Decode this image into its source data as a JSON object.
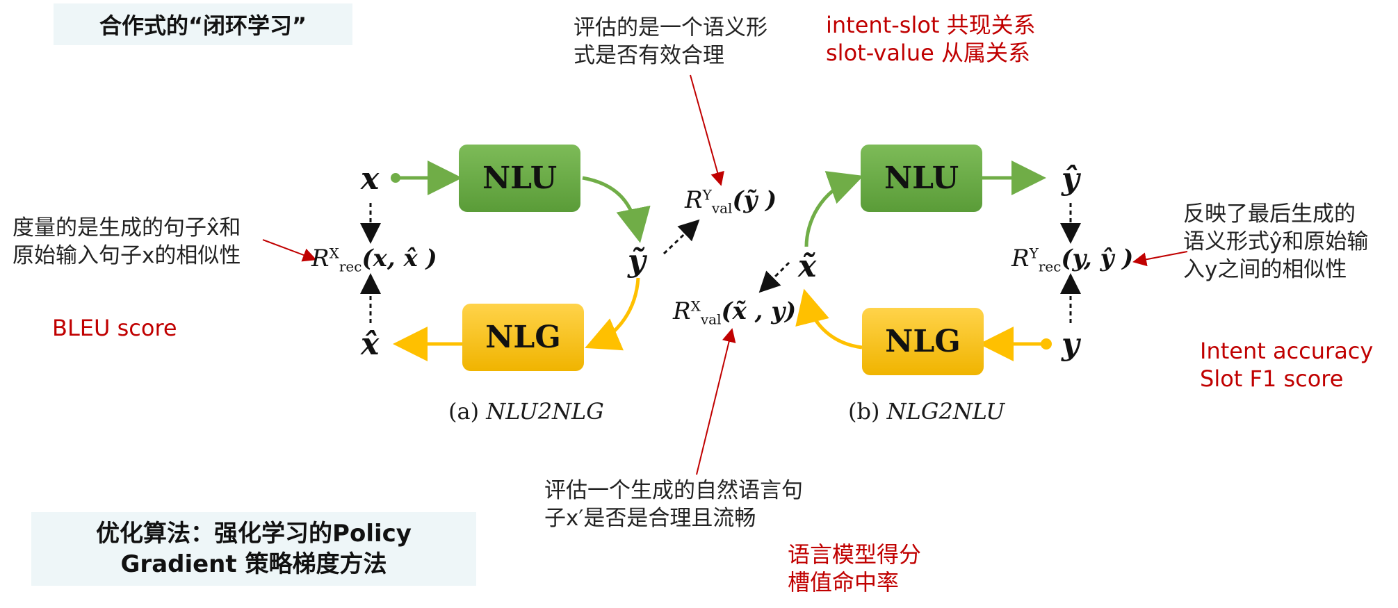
{
  "title_top": "合作式的“闭环学习”",
  "title_bottom_line1": "优化算法：强化学习的Policy",
  "title_bottom_line2": "Gradient 策略梯度方法",
  "boxes": {
    "nlu_left": "NLU",
    "nlg_left": "NLG",
    "nlu_right": "NLU",
    "nlg_right": "NLG"
  },
  "captions": {
    "a_prefix": "(a) ",
    "a_name": "NLU2NLG",
    "b_prefix": "(b) ",
    "b_name": "NLG2NLU"
  },
  "variables": {
    "x": "x",
    "x_hat": "x̂",
    "y_tilde": "ỹ",
    "x_tilde": "x̃",
    "y_hat": "ŷ",
    "y": "y"
  },
  "rewards": {
    "R": "R",
    "rec_x": {
      "sub": "rec",
      "sup": "X",
      "args": "(x, x̂ )"
    },
    "val_y": {
      "sub": "val",
      "sup": "Y",
      "args": "(ỹ )"
    },
    "val_x": {
      "sub": "val",
      "sup": "X",
      "args": "(x̃ , y)"
    },
    "rec_y": {
      "sub": "rec",
      "sup": "Y",
      "args": "(y, ŷ )"
    }
  },
  "notes": {
    "val_y_1": "评估的是一个语义形",
    "val_y_2": "式是否有效合理",
    "rec_x_1": "度量的是生成的句子x̂和",
    "rec_x_2": "原始输入句子x的相似性",
    "rec_y_1": "反映了最后生成的",
    "rec_y_2": "语义形式ŷ和原始输",
    "rec_y_3": "入y之间的相似性",
    "val_x_1": "评估一个生成的自然语言句",
    "val_x_2": "子x′是否是合理且流畅"
  },
  "metrics": {
    "intent_slot_1": "intent-slot 共现关系",
    "intent_slot_2": "slot-value 从属关系",
    "bleu": "BLEU score",
    "intent_acc": "Intent accuracy",
    "slot_f1": "Slot F1 score",
    "lm_1": "语言模型得分",
    "lm_2": "槽值命中率"
  },
  "colors": {
    "green_arrow": "#70ad47",
    "yellow_arrow": "#ffc000",
    "red_arrow": "#c00000",
    "title_bg": "#eef6f8"
  }
}
